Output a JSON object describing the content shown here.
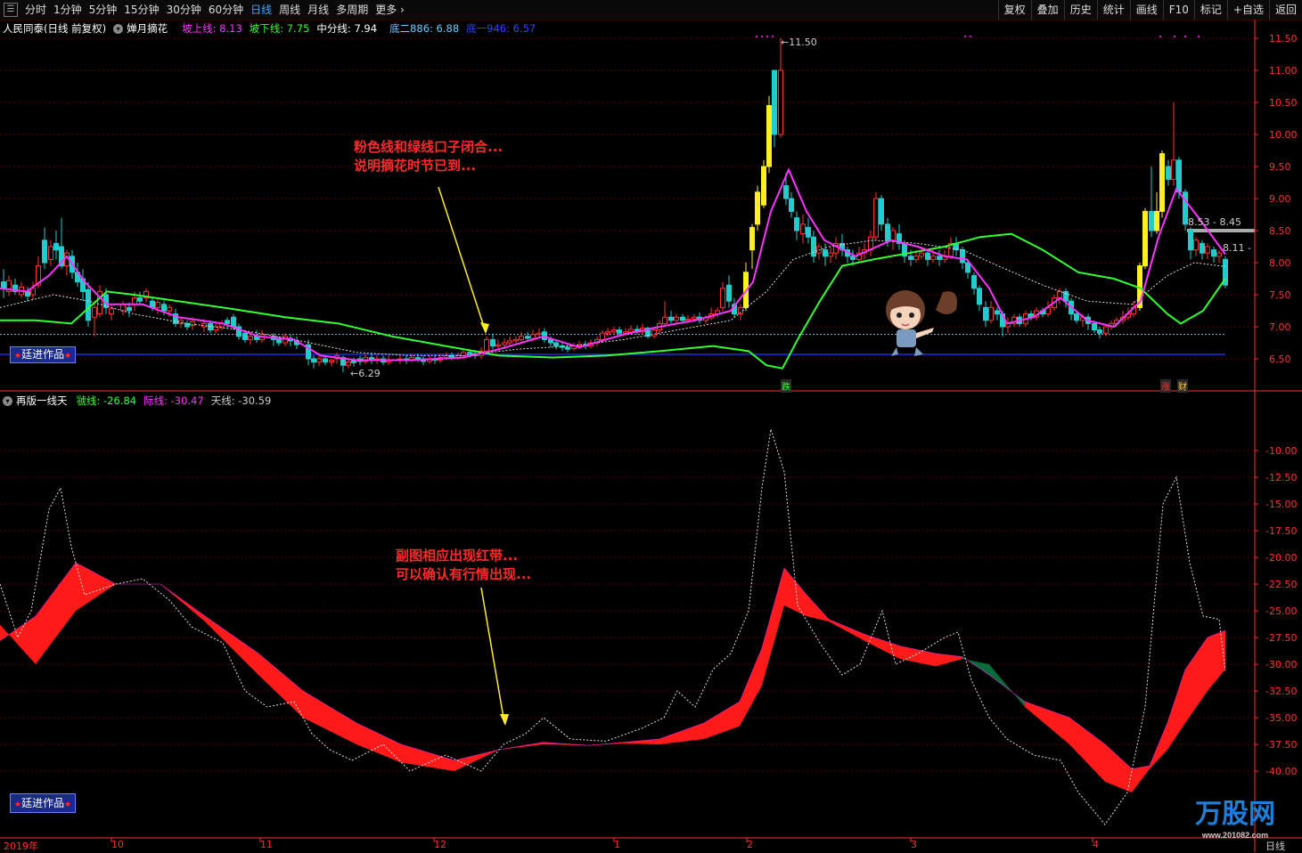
{
  "toolbar": {
    "periods": [
      "分时",
      "1分钟",
      "5分钟",
      "15分钟",
      "30分钟",
      "60分钟",
      "日线",
      "周线",
      "月线",
      "多周期",
      "更多"
    ],
    "active": "日线",
    "right_buttons": [
      "复权",
      "叠加",
      "历史",
      "统计",
      "画线",
      "F10",
      "标记",
      "+自选",
      "返回"
    ]
  },
  "main_panel": {
    "stock_title": "人民同泰(日线 前复权)",
    "indicator_name": "婵月摘花",
    "values": [
      {
        "label": "坡上线: 8.13",
        "color": "#ff33ff"
      },
      {
        "label": "坡下线: 7.75",
        "color": "#33ff33"
      },
      {
        "label": "中分线: 7.94",
        "color": "#ffffff"
      },
      {
        "label": "底二886: 6.88",
        "color": "#66ccff"
      },
      {
        "label": "底一946: 6.57",
        "color": "#3344ff"
      }
    ],
    "high_label": "11.50",
    "low_label": "6.29",
    "range_label_1": "8.53 - 8.45",
    "range_label_2": "8.11 - 8",
    "signal_fall": "跌",
    "signal_rise": "涨",
    "signal_wealth": "财",
    "callout_line1": "粉色线和绿线口子闭合...",
    "callout_line2": "说明摘花时节已到...",
    "badge": "廷进作品",
    "y_ticks": [
      "11.50",
      "11.00",
      "10.50",
      "10.00",
      "9.50",
      "9.00",
      "8.50",
      "8.00",
      "7.50",
      "7.00",
      "6.50"
    ]
  },
  "sub_panel": {
    "indicator_name": "再版一线天",
    "values": [
      {
        "label": "虢线: -26.84",
        "color": "#33ff33"
      },
      {
        "label": "际线: -30.47",
        "color": "#ff33ff"
      },
      {
        "label": "天线: -30.59",
        "color": "#cccccc"
      }
    ],
    "callout_line1": "副图相应出现红带...",
    "callout_line2": "可以确认有行情出现...",
    "badge": "廷进作品",
    "y_ticks": [
      "-10.00",
      "-12.50",
      "-15.00",
      "-17.50",
      "-20.00",
      "-22.50",
      "-25.00",
      "-27.50",
      "-30.00",
      "-32.50",
      "-35.00",
      "-37.50",
      "-40.00"
    ]
  },
  "x_axis": {
    "labels": [
      "2019年",
      "10",
      "11",
      "12",
      "1",
      "2",
      "3",
      "4"
    ],
    "period_label": "日线"
  },
  "watermark": {
    "brand": "万股网",
    "url": "www.201082.com"
  },
  "colors": {
    "up": "#ff3333",
    "down": "#22cccc",
    "pink": "#ff33ff",
    "green": "#33ff33",
    "axis": "#ff3030"
  }
}
